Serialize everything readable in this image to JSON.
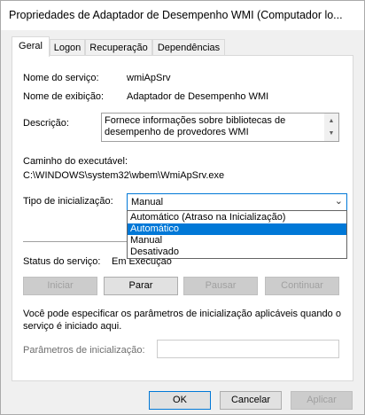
{
  "window": {
    "title": "Propriedades de Adaptador de Desempenho WMI (Computador lo..."
  },
  "tabs": [
    {
      "label": "Geral",
      "active": true
    },
    {
      "label": "Logon",
      "active": false
    },
    {
      "label": "Recuperação",
      "active": false
    },
    {
      "label": "Dependências",
      "active": false
    }
  ],
  "general": {
    "service_name_label": "Nome do serviço:",
    "service_name_value": "wmiApSrv",
    "display_name_label": "Nome de exibição:",
    "display_name_value": "Adaptador de Desempenho WMI",
    "description_label": "Descrição:",
    "description_value": "Fornece informações sobre bibliotecas de desempenho de provedores WMI (Instrumentação",
    "path_label": "Caminho do executável:",
    "path_value": "C:\\WINDOWS\\system32\\wbem\\WmiApSrv.exe",
    "startup_type_label": "Tipo de inicialização:",
    "startup_type_value": "Manual",
    "startup_options": [
      {
        "label": "Automático (Atraso na Inicialização)",
        "selected": false
      },
      {
        "label": "Automático",
        "selected": true
      },
      {
        "label": "Manual",
        "selected": false
      },
      {
        "label": "Desativado",
        "selected": false
      }
    ],
    "status_label": "Status do serviço:",
    "status_value": "Em Execução",
    "buttons": {
      "start": "Iniciar",
      "stop": "Parar",
      "pause": "Pausar",
      "resume": "Continuar"
    },
    "info_text": "Você pode especificar os parâmetros de inicialização aplicáveis quando o serviço é iniciado aqui.",
    "params_label": "Parâmetros de inicialização:",
    "params_value": ""
  },
  "footer": {
    "ok": "OK",
    "cancel": "Cancelar",
    "apply": "Aplicar"
  },
  "colors": {
    "accent": "#0078d7",
    "disabled_text": "#a0a0a0"
  }
}
